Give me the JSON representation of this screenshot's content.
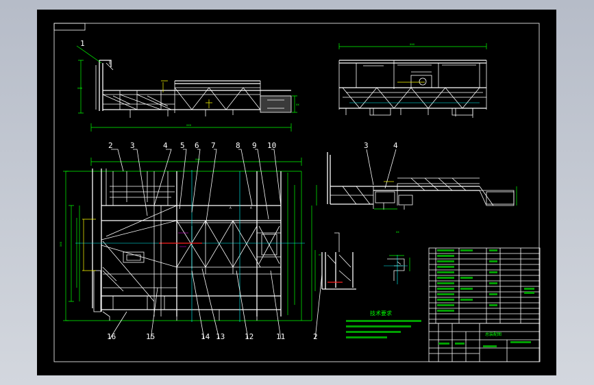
{
  "balloons": {
    "b1": "1",
    "b2": "2",
    "b3": "3",
    "b4": "4",
    "b5": "5",
    "b6": "6",
    "b7": "7",
    "b8": "8",
    "b9": "9",
    "b10": "10",
    "b11": "11",
    "b12": "12",
    "b13": "13",
    "b14": "14",
    "b15": "15",
    "b16": "16",
    "side_b3": "3",
    "side_b4": "4",
    "det_b2": "2"
  },
  "notes": {
    "title": "技术要求"
  },
  "title_block": {
    "name": "总装配图"
  },
  "colors": {
    "background": "#000000",
    "outline": "#ffffff",
    "dimension": "#00ff00",
    "centerline": "#00ffff",
    "hidden": "#ffff00",
    "highlight": "#ff2020"
  }
}
